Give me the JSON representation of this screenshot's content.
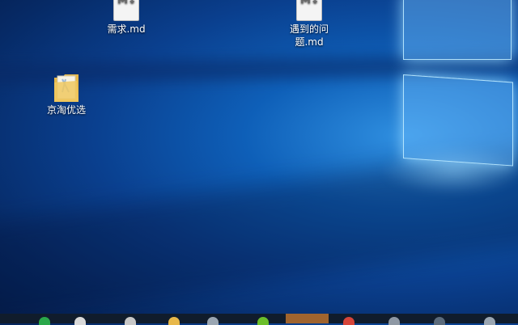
{
  "desktop": {
    "icons": [
      {
        "label": "需求.md",
        "type": "markdown-file",
        "icon": "markdown-file-icon"
      },
      {
        "label": "遇到的问题.md",
        "type": "markdown-file",
        "icon": "markdown-file-icon"
      },
      {
        "label": "京淘优选",
        "type": "folder",
        "icon": "folder-icon"
      }
    ]
  },
  "taskbar": {
    "items": [
      {
        "icon": "green-app-icon",
        "color": "#2aa84a"
      },
      {
        "icon": "file-explorer-icon",
        "color": "#d9d9d9"
      },
      {
        "icon": "window-app-icon",
        "color": "#c8c8c8"
      },
      {
        "icon": "folder-icon",
        "color": "#e8b84a"
      },
      {
        "icon": "app-icon",
        "color": "#9aa6b2"
      },
      {
        "icon": "green-circle-app-icon",
        "color": "#6bbf2a"
      },
      {
        "icon": "active-app-icon",
        "color": "#a0642e",
        "active": true
      },
      {
        "icon": "red-app-icon",
        "color": "#d6453a"
      },
      {
        "icon": "app-icon",
        "color": "#8e98a4"
      },
      {
        "icon": "app-icon",
        "color": "#5b6b7c"
      },
      {
        "icon": "app-icon",
        "color": "#9aa6b2"
      }
    ]
  }
}
